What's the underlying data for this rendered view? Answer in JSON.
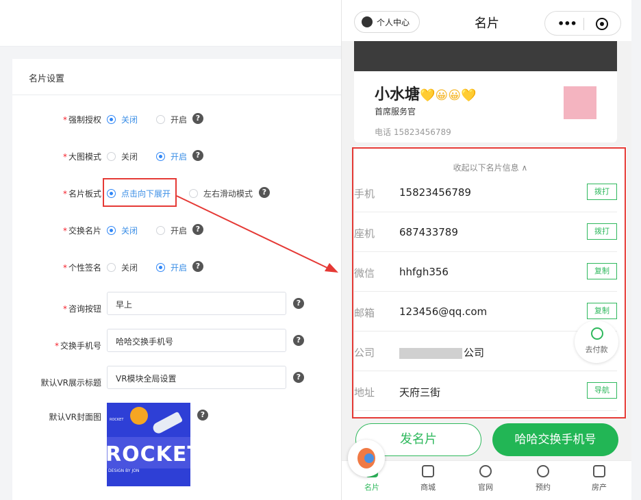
{
  "settings": {
    "panel_title": "名片设置",
    "rows": [
      {
        "label": "强制授权",
        "required": true,
        "options": [
          "关闭",
          "开启"
        ],
        "selected": 0
      },
      {
        "label": "大图模式",
        "required": true,
        "options": [
          "关闭",
          "开启"
        ],
        "selected": 1
      },
      {
        "label": "名片板式",
        "required": true,
        "options": [
          "点击向下展开",
          "左右滑动模式"
        ],
        "selected": 0
      },
      {
        "label": "交换名片",
        "required": true,
        "options": [
          "关闭",
          "开启"
        ],
        "selected": 0
      },
      {
        "label": "个性签名",
        "required": true,
        "options": [
          "关闭",
          "开启"
        ],
        "selected": 1
      }
    ],
    "consult_button": {
      "label": "咨询按钮",
      "value": "早上"
    },
    "exchange_phone": {
      "label": "交换手机号",
      "value": "哈哈交换手机号"
    },
    "vr_title": {
      "label": "默认VR展示标题",
      "value": "VR模块全局设置"
    },
    "vr_cover": {
      "label": "默认VR封面图",
      "image_text": "ROCKET",
      "image_caption": "DESIGN BY JON",
      "image_small": "ROCKET"
    },
    "required_mark": "*",
    "help_glyph": "?"
  },
  "phone": {
    "user_center": "个人中心",
    "nav_title": "名片",
    "capsule_dots": "•••",
    "card": {
      "name": "小水塘",
      "name_emoji": "💛😀😀💛",
      "title": "首席服务官",
      "phone": "电话 15823456789"
    },
    "collapse_text": "收起以下名片信息",
    "collapse_icon": "∧",
    "info_rows": [
      {
        "key": "手机",
        "value": "15823456789",
        "action": "拨打"
      },
      {
        "key": "座机",
        "value": "687433789",
        "action": "拨打"
      },
      {
        "key": "微信",
        "value": "hhfgh356",
        "action": "复制"
      },
      {
        "key": "邮箱",
        "value": "123456@qq.com",
        "action": "复制"
      },
      {
        "key": "公司",
        "value": "公司",
        "action": ""
      },
      {
        "key": "地址",
        "value": "天府三街",
        "action": "导航"
      }
    ],
    "pay_label": "去付款",
    "send_card": "发名片",
    "swap_phone": "哈哈交换手机号",
    "tabs": [
      "名片",
      "商城",
      "官网",
      "预约",
      "房产"
    ],
    "active_tab": 0,
    "accent_color": "#2eb85c"
  },
  "colors": {
    "highlight": "#e53935",
    "radio_active": "#2f86f6"
  }
}
